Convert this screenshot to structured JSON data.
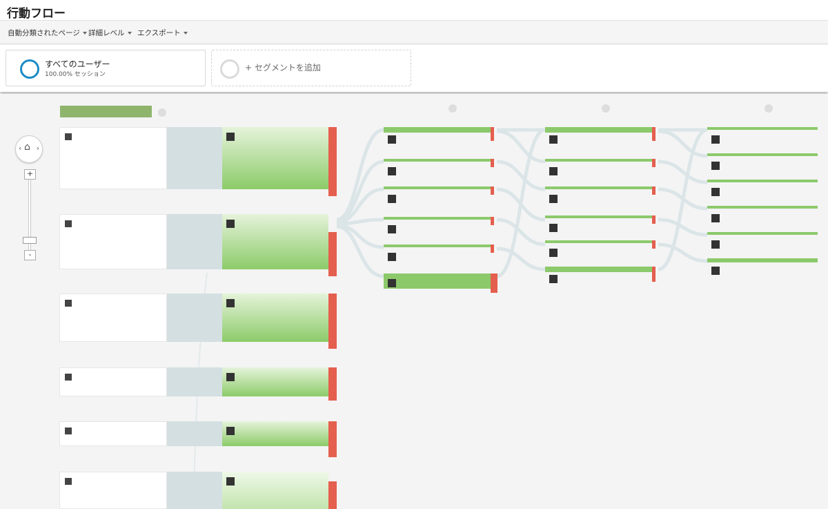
{
  "header": {
    "title": "行動フロー"
  },
  "toolbar": {
    "items": [
      "自動分類されたページ",
      "詳細レベル",
      "エクスポート"
    ]
  },
  "segments": {
    "active": {
      "name": "すべてのユーザー",
      "sub": "100.00% セッション"
    },
    "add_label": "+ セグメントを追加"
  },
  "zoom": {
    "plus": "+",
    "minus": "-"
  },
  "colors": {
    "accent": "#1b8bc6",
    "green": "#8cc96b",
    "drop": "#e55f4e",
    "link": "#d4dfe2"
  }
}
